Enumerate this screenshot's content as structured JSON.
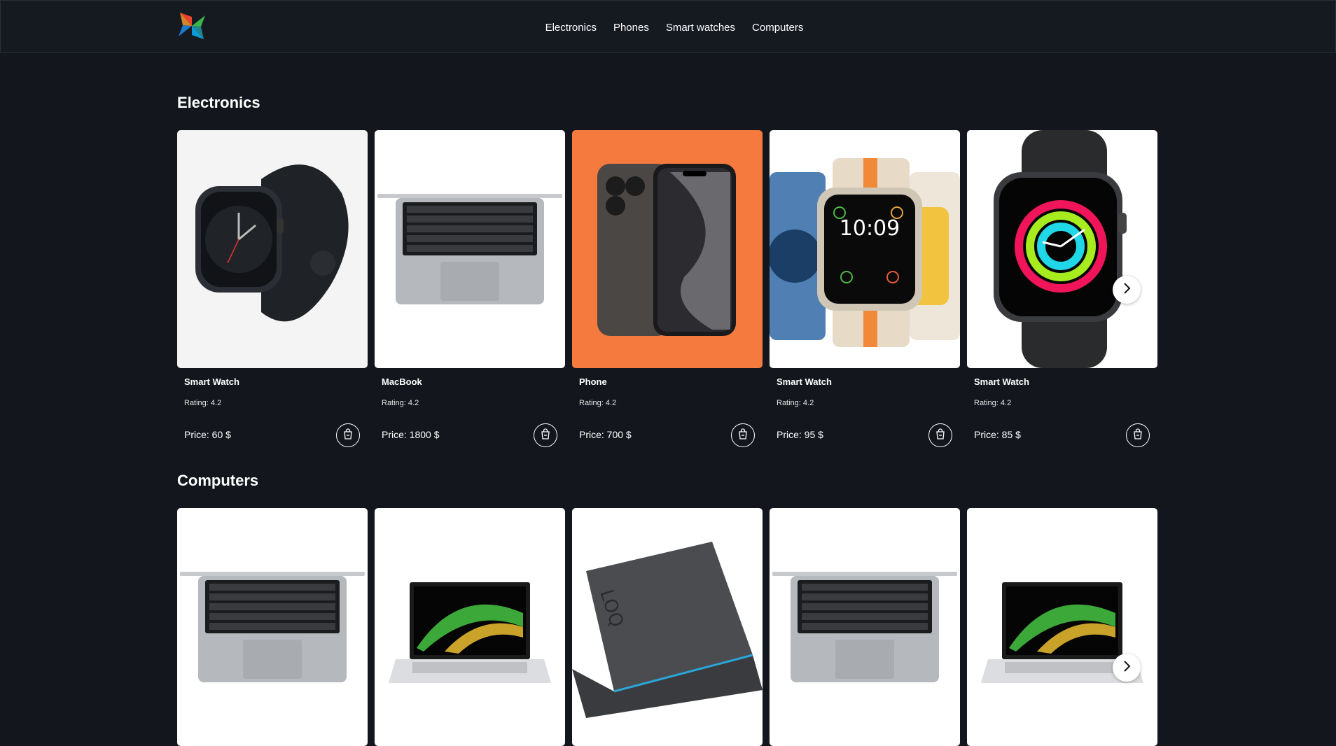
{
  "nav": {
    "logo_icon": "pinwheel-logo-icon",
    "links": [
      "Electronics",
      "Phones",
      "Smart watches",
      "Computers"
    ]
  },
  "colors": {
    "background": "#13171d",
    "navbar": "#151920",
    "phone_card_bg": "#f47a3e"
  },
  "sections": [
    {
      "title": "Electronics",
      "products": [
        {
          "name": "Smart Watch",
          "rating": "Rating: 4.2",
          "price": "Price: 60 $",
          "image": "smartwatch-black-image"
        },
        {
          "name": "MacBook",
          "rating": "Rating: 4.2",
          "price": "Price: 1800 $",
          "image": "macbook-image"
        },
        {
          "name": "Phone",
          "rating": "Rating: 4.2",
          "price": "Price: 700 $",
          "image": "iphone-image"
        },
        {
          "name": "Smart Watch",
          "rating": "Rating: 4.2",
          "price": "Price: 95 $",
          "image": "smartwatch-ultra-image"
        },
        {
          "name": "Smart Watch",
          "rating": "Rating: 4.2",
          "price": "Price: 85 $",
          "image": "smartwatch-activity-image"
        }
      ]
    },
    {
      "title": "Computers",
      "products": [
        {
          "image": "macbook-image"
        },
        {
          "image": "acer-laptop-image"
        },
        {
          "image": "lenovo-loq-laptop-image"
        },
        {
          "image": "macbook-image"
        },
        {
          "image": "acer-laptop-image"
        }
      ]
    }
  ],
  "icons": {
    "cart": "shopping-bag-icon",
    "next": "chevron-right-icon"
  }
}
